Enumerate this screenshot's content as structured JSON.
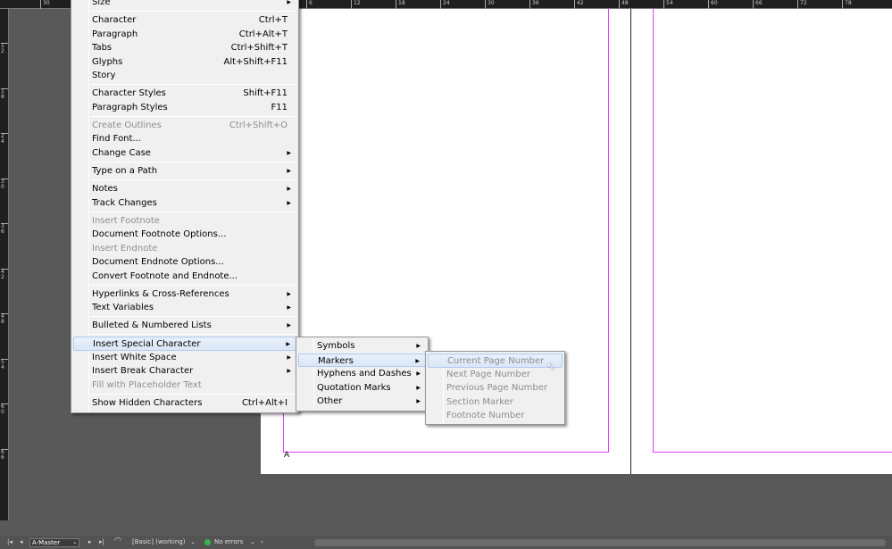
{
  "ruler": {
    "top_labels": [
      "30",
      "6",
      "12",
      "18",
      "24",
      "30",
      "36",
      "42",
      "48",
      "54",
      "60",
      "66",
      "72",
      "78"
    ],
    "left_labels": [
      "1 2",
      "1 8",
      "2 4",
      "3 0",
      "3 6",
      "4 2",
      "4 8",
      "5 4",
      "6 0",
      "6 6"
    ]
  },
  "page": {
    "master_prefix": "A",
    "margin_color": "#e040ff"
  },
  "main_menu": [
    {
      "label": "Size",
      "sub": true
    },
    {
      "sep": true
    },
    {
      "label": "Character",
      "shortcut": "Ctrl+T"
    },
    {
      "label": "Paragraph",
      "shortcut": "Ctrl+Alt+T"
    },
    {
      "label": "Tabs",
      "shortcut": "Ctrl+Shift+T"
    },
    {
      "label": "Glyphs",
      "shortcut": "Alt+Shift+F11"
    },
    {
      "label": "Story"
    },
    {
      "sep": true
    },
    {
      "label": "Character Styles",
      "shortcut": "Shift+F11"
    },
    {
      "label": "Paragraph Styles",
      "shortcut": "F11"
    },
    {
      "sep": true
    },
    {
      "label": "Create Outlines",
      "shortcut": "Ctrl+Shift+O",
      "disabled": true
    },
    {
      "label": "Find Font..."
    },
    {
      "label": "Change Case",
      "sub": true
    },
    {
      "sep": true
    },
    {
      "label": "Type on a Path",
      "sub": true
    },
    {
      "sep": true
    },
    {
      "label": "Notes",
      "sub": true
    },
    {
      "label": "Track Changes",
      "sub": true
    },
    {
      "sep": true
    },
    {
      "label": "Insert Footnote",
      "disabled": true
    },
    {
      "label": "Document Footnote Options..."
    },
    {
      "label": "Insert Endnote",
      "disabled": true
    },
    {
      "label": "Document Endnote Options..."
    },
    {
      "label": "Convert Footnote and Endnote..."
    },
    {
      "sep": true
    },
    {
      "label": "Hyperlinks & Cross-References",
      "sub": true
    },
    {
      "label": "Text Variables",
      "sub": true
    },
    {
      "sep": true
    },
    {
      "label": "Bulleted & Numbered Lists",
      "sub": true
    },
    {
      "sep": true
    },
    {
      "label": "Insert Special Character",
      "sub": true,
      "highlighted": true
    },
    {
      "label": "Insert White Space",
      "sub": true
    },
    {
      "label": "Insert Break Character",
      "sub": true
    },
    {
      "label": "Fill with Placeholder Text",
      "disabled": true
    },
    {
      "sep": true
    },
    {
      "label": "Show Hidden Characters",
      "shortcut": "Ctrl+Alt+I"
    }
  ],
  "special_char_menu": [
    {
      "label": "Symbols",
      "sub": true
    },
    {
      "label": "Markers",
      "sub": true,
      "highlighted": true
    },
    {
      "label": "Hyphens and Dashes",
      "sub": true
    },
    {
      "label": "Quotation Marks",
      "sub": true
    },
    {
      "label": "Other",
      "sub": true
    }
  ],
  "markers_menu": [
    {
      "label": "Current Page Number",
      "disabled": true,
      "highlighted": true
    },
    {
      "label": "Next Page Number",
      "disabled": true
    },
    {
      "label": "Previous Page Number",
      "disabled": true
    },
    {
      "label": "Section Marker",
      "disabled": true
    },
    {
      "label": "Footnote Number",
      "disabled": true
    }
  ],
  "status": {
    "page": "A-Master",
    "profile": "[Basic] (working)",
    "preflight": "No errors",
    "preflight_color": "#3cb34a"
  }
}
